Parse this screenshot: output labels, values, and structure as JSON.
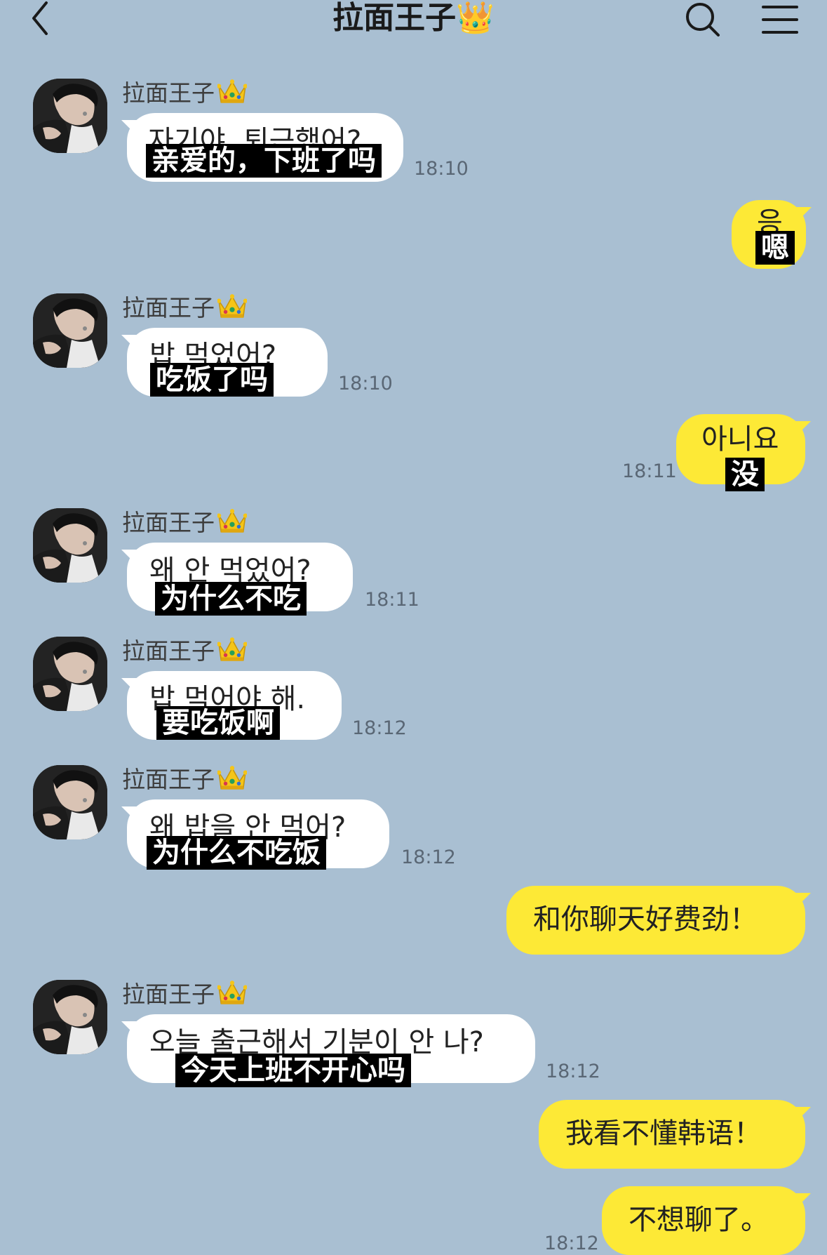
{
  "header": {
    "title": "拉面王子👑",
    "back_icon": "chevron-left-icon",
    "search_icon": "search-icon",
    "menu_icon": "hamburger-menu-icon"
  },
  "colors": {
    "background": "#a9bfd2",
    "incoming_bubble": "#ffffff",
    "outgoing_bubble": "#fde936",
    "subtitle_bg": "#000000",
    "subtitle_text": "#ffffff"
  },
  "messages": [
    {
      "direction": "in",
      "sender": "拉面王子",
      "korean": "자기야, 퇴근했어?",
      "chinese": "亲爱的，下班了吗",
      "time": "18:10"
    },
    {
      "direction": "out",
      "korean": "응",
      "chinese": "嗯",
      "time": ""
    },
    {
      "direction": "in",
      "sender": "拉面王子",
      "korean": "밥 먹었어?",
      "chinese": "吃饭了吗",
      "time": "18:10"
    },
    {
      "direction": "out",
      "korean": "아니요",
      "chinese": "没",
      "time": "18:11"
    },
    {
      "direction": "in",
      "sender": "拉面王子",
      "korean": "왜 안 먹었어?",
      "chinese": "为什么不吃",
      "time": "18:11"
    },
    {
      "direction": "in",
      "sender": "拉面王子",
      "korean": "밥 먹어야 해.",
      "chinese": "要吃饭啊",
      "time": "18:12"
    },
    {
      "direction": "in",
      "sender": "拉面王子",
      "korean": "왜 밥을 안 먹어?",
      "chinese": "为什么不吃饭",
      "time": "18:12"
    },
    {
      "direction": "out",
      "text": "和你聊天好费劲！",
      "time": ""
    },
    {
      "direction": "in",
      "sender": "拉面王子",
      "korean": "오늘 출근해서 기분이 안 나?",
      "chinese": "今天上班不开心吗",
      "time": "18:12"
    },
    {
      "direction": "out",
      "text": "我看不懂韩语！",
      "time": ""
    },
    {
      "direction": "out",
      "text": "不想聊了。",
      "time": "18:12"
    }
  ]
}
